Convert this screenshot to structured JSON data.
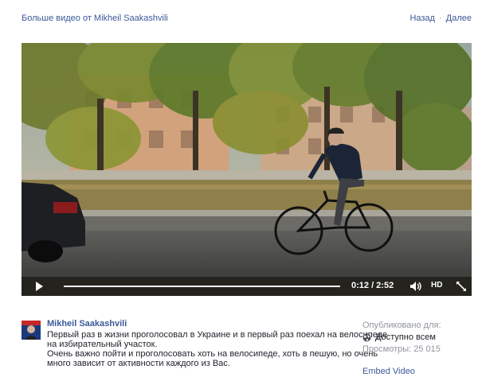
{
  "header": {
    "more_videos": "Больше видео от Mikheil Saakashvili",
    "nav_back": "Назад",
    "nav_sep": "·",
    "nav_next": "Далее"
  },
  "player": {
    "time": "0:12 / 2:52",
    "progress": 0.07,
    "quality_label": "HD",
    "icons": [
      "play-icon",
      "volume-icon",
      "fullscreen-icon"
    ]
  },
  "post": {
    "author": "Mikheil Saakashvili",
    "lines": [
      "Первый раз в жизни проголосовал в Украине и в первый раз поехал на велосипеде",
      "на избирательный участок.",
      "Очень важно пойти и проголосовать хоть на велосипеде, хоть в пешую, но очень",
      "много зависит от активности каждого из Вас."
    ]
  },
  "meta": {
    "published_label": "Опубликовано для:",
    "audience": "Доступно всем",
    "views": "Просмотры: 25 015",
    "embed": "Embed Video"
  },
  "colors": {
    "link": "#3b5998",
    "muted": "#90949c",
    "text": "#1d2129"
  }
}
